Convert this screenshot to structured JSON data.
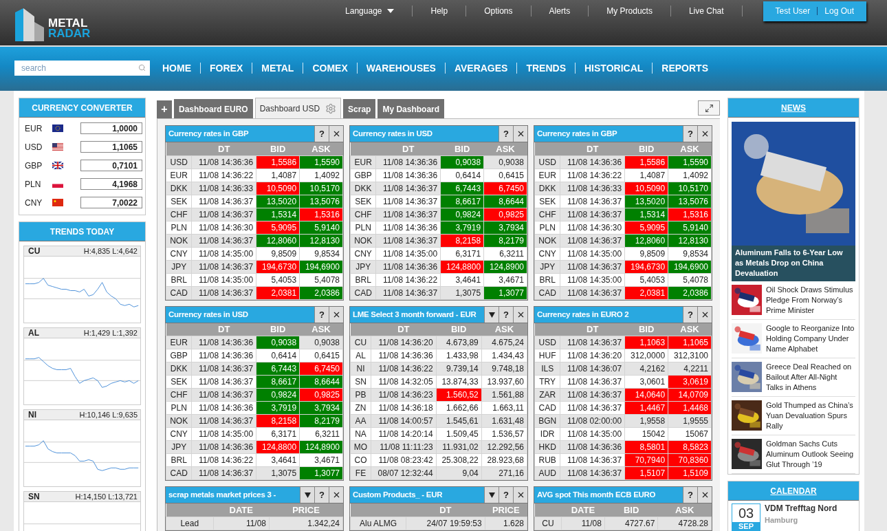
{
  "logo": {
    "line1": "METAL",
    "line2": "RADAR"
  },
  "top_menu": [
    {
      "label": "Language",
      "dropdown": true
    },
    {
      "label": "Help",
      "dropdown": false
    },
    {
      "label": "Options",
      "dropdown": false
    },
    {
      "label": "Alerts",
      "dropdown": false
    },
    {
      "label": "My Products",
      "dropdown": false
    },
    {
      "label": "Live Chat",
      "dropdown": false
    }
  ],
  "user": {
    "name": "Test User",
    "logout": "Log Out"
  },
  "search": {
    "placeholder": "search"
  },
  "nav": [
    "HOME",
    "FOREX",
    "METAL",
    "COMEX",
    "WAREHOUSES",
    "AVERAGES",
    "TRENDS",
    "HISTORICAL",
    "REPORTS"
  ],
  "converter": {
    "title": "CURRENCY CONVERTER",
    "rows": [
      {
        "code": "EUR",
        "value": "1,0000"
      },
      {
        "code": "USD",
        "value": "1,1065"
      },
      {
        "code": "GBP",
        "value": "0,7101"
      },
      {
        "code": "PLN",
        "value": "4,1968"
      },
      {
        "code": "CNY",
        "value": "7,0022"
      }
    ]
  },
  "trends": {
    "title": "TRENDS TODAY",
    "items": [
      {
        "metal": "CU",
        "range": "H:4,835 L:4,642"
      },
      {
        "metal": "AL",
        "range": "H:1,429 L:1,392"
      },
      {
        "metal": "NI",
        "range": "H:10,146 L:9,635"
      },
      {
        "metal": "SN",
        "range": "H:14,150 L:13,721"
      }
    ]
  },
  "tabs": {
    "add": "+",
    "items": [
      {
        "label": "Dashboard EURO",
        "selected": false
      },
      {
        "label": "Dashboard USD",
        "selected": true
      },
      {
        "label": "Scrap",
        "selected": false
      },
      {
        "label": "My Dashboard",
        "selected": false
      }
    ]
  },
  "widgets": [
    {
      "title": "Currency rates in GBP",
      "dropdown": false,
      "help": "?",
      "columns": [
        "",
        "DT",
        "BID",
        "ASK"
      ],
      "rows": [
        {
          "cells": [
            "USD",
            "11/08 14:36:36",
            {
              "text": "1,5586",
              "color": "#ff0000"
            },
            {
              "text": "1,5590",
              "color": "#008000"
            }
          ]
        },
        {
          "cells": [
            "EUR",
            "11/08 14:36:22",
            "1,4087",
            "1,4092"
          ]
        },
        {
          "cells": [
            "DKK",
            "11/08 14:36:33",
            {
              "text": "10,5090",
              "color": "#ff0000"
            },
            {
              "text": "10,5170",
              "color": "#008000"
            }
          ]
        },
        {
          "cells": [
            "SEK",
            "11/08 14:36:37",
            {
              "text": "13,5020",
              "color": "#008000"
            },
            {
              "text": "13,5076",
              "color": "#008000"
            }
          ]
        },
        {
          "cells": [
            "CHF",
            "11/08 14:36:37",
            {
              "text": "1,5314",
              "color": "#008000"
            },
            {
              "text": "1,5316",
              "color": "#ff0000"
            }
          ]
        },
        {
          "cells": [
            "PLN",
            "11/08 14:36:30",
            {
              "text": "5,9095",
              "color": "#ff0000"
            },
            {
              "text": "5,9140",
              "color": "#008000"
            }
          ]
        },
        {
          "cells": [
            "NOK",
            "11/08 14:36:37",
            {
              "text": "12,8060",
              "color": "#008000"
            },
            {
              "text": "12,8130",
              "color": "#008000"
            }
          ]
        },
        {
          "cells": [
            "CNY",
            "11/08 14:35:00",
            "9,8509",
            "9,8534"
          ]
        },
        {
          "cells": [
            "JPY",
            "11/08 14:36:37",
            {
              "text": "194,6730",
              "color": "#ff0000"
            },
            {
              "text": "194,6900",
              "color": "#008000"
            }
          ]
        },
        {
          "cells": [
            "BRL",
            "11/08 14:35:00",
            "5,4053",
            "5,4078"
          ]
        },
        {
          "cells": [
            "CAD",
            "11/08 14:36:37",
            {
              "text": "2,0381",
              "color": "#ff0000"
            },
            {
              "text": "2,0386",
              "color": "#008000"
            }
          ]
        }
      ]
    },
    {
      "title": "Currency rates in USD",
      "dropdown": false,
      "help": "?",
      "columns": [
        "",
        "DT",
        "BID",
        "ASK"
      ],
      "rows": [
        {
          "cells": [
            "EUR",
            "11/08 14:36:36",
            {
              "text": "0,9038",
              "color": "#008000"
            },
            "0,9038"
          ]
        },
        {
          "cells": [
            "GBP",
            "11/08 14:36:36",
            "0,6414",
            "0,6415"
          ]
        },
        {
          "cells": [
            "DKK",
            "11/08 14:36:37",
            {
              "text": "6,7443",
              "color": "#008000"
            },
            {
              "text": "6,7450",
              "color": "#ff0000"
            }
          ]
        },
        {
          "cells": [
            "SEK",
            "11/08 14:36:37",
            {
              "text": "8,6617",
              "color": "#008000"
            },
            {
              "text": "8,6644",
              "color": "#008000"
            }
          ]
        },
        {
          "cells": [
            "CHF",
            "11/08 14:36:37",
            {
              "text": "0,9824",
              "color": "#008000"
            },
            {
              "text": "0,9825",
              "color": "#ff0000"
            }
          ]
        },
        {
          "cells": [
            "PLN",
            "11/08 14:36:36",
            {
              "text": "3,7919",
              "color": "#008000"
            },
            {
              "text": "3,7934",
              "color": "#008000"
            }
          ]
        },
        {
          "cells": [
            "NOK",
            "11/08 14:36:37",
            {
              "text": "8,2158",
              "color": "#ff0000"
            },
            {
              "text": "8,2179",
              "color": "#008000"
            }
          ]
        },
        {
          "cells": [
            "CNY",
            "11/08 14:35:00",
            "6,3171",
            "6,3211"
          ]
        },
        {
          "cells": [
            "JPY",
            "11/08 14:36:36",
            {
              "text": "124,8800",
              "color": "#ff0000"
            },
            {
              "text": "124,8900",
              "color": "#008000"
            }
          ]
        },
        {
          "cells": [
            "BRL",
            "11/08 14:36:22",
            "3,4641",
            "3,4671"
          ]
        },
        {
          "cells": [
            "CAD",
            "11/08 14:36:37",
            "1,3075",
            {
              "text": "1,3077",
              "color": "#008000"
            }
          ]
        }
      ]
    },
    {
      "title": "Currency rates in GBP",
      "dropdown": false,
      "help": "?",
      "columns": [
        "",
        "DT",
        "BID",
        "ASK"
      ],
      "rows": [
        {
          "cells": [
            "USD",
            "11/08 14:36:36",
            {
              "text": "1,5586",
              "color": "#ff0000"
            },
            {
              "text": "1,5590",
              "color": "#008000"
            }
          ]
        },
        {
          "cells": [
            "EUR",
            "11/08 14:36:22",
            "1,4087",
            "1,4092"
          ]
        },
        {
          "cells": [
            "DKK",
            "11/08 14:36:33",
            {
              "text": "10,5090",
              "color": "#ff0000"
            },
            {
              "text": "10,5170",
              "color": "#008000"
            }
          ]
        },
        {
          "cells": [
            "SEK",
            "11/08 14:36:37",
            {
              "text": "13,5020",
              "color": "#008000"
            },
            {
              "text": "13,5076",
              "color": "#008000"
            }
          ]
        },
        {
          "cells": [
            "CHF",
            "11/08 14:36:37",
            {
              "text": "1,5314",
              "color": "#008000"
            },
            {
              "text": "1,5316",
              "color": "#ff0000"
            }
          ]
        },
        {
          "cells": [
            "PLN",
            "11/08 14:36:30",
            {
              "text": "5,9095",
              "color": "#ff0000"
            },
            {
              "text": "5,9140",
              "color": "#008000"
            }
          ]
        },
        {
          "cells": [
            "NOK",
            "11/08 14:36:37",
            {
              "text": "12,8060",
              "color": "#008000"
            },
            {
              "text": "12,8130",
              "color": "#008000"
            }
          ]
        },
        {
          "cells": [
            "CNY",
            "11/08 14:35:00",
            "9,8509",
            "9,8534"
          ]
        },
        {
          "cells": [
            "JPY",
            "11/08 14:36:37",
            {
              "text": "194,6730",
              "color": "#ff0000"
            },
            {
              "text": "194,6900",
              "color": "#008000"
            }
          ]
        },
        {
          "cells": [
            "BRL",
            "11/08 14:35:00",
            "5,4053",
            "5,4078"
          ]
        },
        {
          "cells": [
            "CAD",
            "11/08 14:36:37",
            {
              "text": "2,0381",
              "color": "#ff0000"
            },
            {
              "text": "2,0386",
              "color": "#008000"
            }
          ]
        }
      ]
    },
    {
      "title": "Currency rates in USD",
      "dropdown": false,
      "help": "?",
      "columns": [
        "",
        "DT",
        "BID",
        "ASK"
      ],
      "rows": [
        {
          "cells": [
            "EUR",
            "11/08 14:36:36",
            {
              "text": "0,9038",
              "color": "#008000"
            },
            "0,9038"
          ]
        },
        {
          "cells": [
            "GBP",
            "11/08 14:36:36",
            "0,6414",
            "0,6415"
          ]
        },
        {
          "cells": [
            "DKK",
            "11/08 14:36:37",
            {
              "text": "6,7443",
              "color": "#008000"
            },
            {
              "text": "6,7450",
              "color": "#ff0000"
            }
          ]
        },
        {
          "cells": [
            "SEK",
            "11/08 14:36:37",
            {
              "text": "8,6617",
              "color": "#008000"
            },
            {
              "text": "8,6644",
              "color": "#008000"
            }
          ]
        },
        {
          "cells": [
            "CHF",
            "11/08 14:36:37",
            {
              "text": "0,9824",
              "color": "#008000"
            },
            {
              "text": "0,9825",
              "color": "#ff0000"
            }
          ]
        },
        {
          "cells": [
            "PLN",
            "11/08 14:36:36",
            {
              "text": "3,7919",
              "color": "#008000"
            },
            {
              "text": "3,7934",
              "color": "#008000"
            }
          ]
        },
        {
          "cells": [
            "NOK",
            "11/08 14:36:37",
            {
              "text": "8,2158",
              "color": "#ff0000"
            },
            {
              "text": "8,2179",
              "color": "#008000"
            }
          ]
        },
        {
          "cells": [
            "CNY",
            "11/08 14:35:00",
            "6,3171",
            "6,3211"
          ]
        },
        {
          "cells": [
            "JPY",
            "11/08 14:36:36",
            {
              "text": "124,8800",
              "color": "#ff0000"
            },
            {
              "text": "124,8900",
              "color": "#008000"
            }
          ]
        },
        {
          "cells": [
            "BRL",
            "11/08 14:36:22",
            "3,4641",
            "3,4671"
          ]
        },
        {
          "cells": [
            "CAD",
            "11/08 14:36:37",
            "1,3075",
            {
              "text": "1,3077",
              "color": "#008000"
            }
          ]
        }
      ]
    },
    {
      "title": "LME Select 3 month forward - EUR",
      "dropdown": true,
      "help": "?",
      "columns": [
        "",
        "DT",
        "BID",
        "ASK"
      ],
      "rows": [
        {
          "cells": [
            "CU",
            "11/08 14:36:20",
            "4.673,89",
            "4.675,24"
          ]
        },
        {
          "cells": [
            "AL",
            "11/08 14:36:36",
            "1.433,98",
            "1.434,43"
          ]
        },
        {
          "cells": [
            "NI",
            "11/08 14:36:22",
            "9.739,14",
            "9.748,18"
          ]
        },
        {
          "cells": [
            "SN",
            "11/08 14:32:05",
            "13.874,33",
            "13.937,60"
          ]
        },
        {
          "cells": [
            "PB",
            "11/08 14:36:23",
            {
              "text": "1.560,52",
              "color": "#ff0000"
            },
            "1.561,88"
          ]
        },
        {
          "cells": [
            "ZN",
            "11/08 14:36:18",
            "1.662,66",
            "1.663,11"
          ]
        },
        {
          "cells": [
            "AA",
            "11/08 14:00:57",
            "1.545,61",
            "1.631,48"
          ]
        },
        {
          "cells": [
            "NA",
            "11/08 14:20:14",
            "1.509,45",
            "1.536,57"
          ]
        },
        {
          "cells": [
            "MO",
            "11/08 11:11:23",
            "11.931,02",
            "12.292,56"
          ]
        },
        {
          "cells": [
            "CO",
            "11/08 08:23:42",
            "25.308,22",
            "28.923,68"
          ]
        },
        {
          "cells": [
            "FE",
            "08/07 12:32:44",
            "9,04",
            "271,16"
          ]
        }
      ]
    },
    {
      "title": "Currency rates in EURO 2",
      "dropdown": false,
      "help": "?",
      "columns": [
        "",
        "DT",
        "BID",
        "ASK"
      ],
      "rows": [
        {
          "cells": [
            "USD",
            "11/08 14:36:37",
            {
              "text": "1,1063",
              "color": "#ff0000"
            },
            {
              "text": "1,1065",
              "color": "#ff0000"
            }
          ]
        },
        {
          "cells": [
            "HUF",
            "11/08 14:36:20",
            "312,0000",
            "312,3100"
          ]
        },
        {
          "cells": [
            "ILS",
            "11/08 14:36:07",
            "4,2162",
            "4,2211"
          ]
        },
        {
          "cells": [
            "TRY",
            "11/08 14:36:37",
            "3,0601",
            {
              "text": "3,0619",
              "color": "#ff0000"
            }
          ]
        },
        {
          "cells": [
            "ZAR",
            "11/08 14:36:37",
            {
              "text": "14,0640",
              "color": "#ff0000"
            },
            {
              "text": "14,0709",
              "color": "#ff0000"
            }
          ]
        },
        {
          "cells": [
            "CAD",
            "11/08 14:36:37",
            {
              "text": "1,4467",
              "color": "#ff0000"
            },
            {
              "text": "1,4468",
              "color": "#ff0000"
            }
          ]
        },
        {
          "cells": [
            "BGN",
            "11/08 02:00:00",
            "1,9558",
            "1,9555"
          ]
        },
        {
          "cells": [
            "IDR",
            "11/08 14:35:00",
            "15042",
            "15067"
          ]
        },
        {
          "cells": [
            "HKD",
            "11/08 14:36:36",
            {
              "text": "8,5801",
              "color": "#ff0000"
            },
            {
              "text": "8,5823",
              "color": "#ff0000"
            }
          ]
        },
        {
          "cells": [
            "RUB",
            "11/08 14:36:37",
            {
              "text": "70,7940",
              "color": "#ff0000"
            },
            {
              "text": "70,8360",
              "color": "#ff0000"
            }
          ]
        },
        {
          "cells": [
            "AUD",
            "11/08 14:36:37",
            {
              "text": "1,5107",
              "color": "#ff0000"
            },
            {
              "text": "1,5109",
              "color": "#ff0000"
            }
          ]
        }
      ]
    },
    {
      "title": "scrap metals market prices 3 -",
      "dropdown": true,
      "help": "?",
      "columns": [
        "",
        "DATE",
        "PRICE"
      ],
      "rows": [
        {
          "cells": [
            "Lead",
            "11/08",
            "1.342,24"
          ]
        }
      ]
    },
    {
      "title": "Custom Products_ - EUR",
      "dropdown": true,
      "help": "?",
      "columns": [
        "",
        "DT",
        "PRICE"
      ],
      "rows": [
        {
          "cells": [
            "Alu ALMG",
            "24/07 19:59:53",
            "1.628"
          ]
        }
      ]
    },
    {
      "title": "AVG spot This month ECB EURO",
      "dropdown": false,
      "help": "?",
      "columns": [
        "",
        "DATE",
        "BID",
        "ASK"
      ],
      "rows": [
        {
          "cells": [
            "CU",
            "11/08",
            "4727.67",
            "4728.28"
          ]
        }
      ]
    }
  ],
  "news": {
    "title": "NEWS",
    "feature": {
      "headline": "Aluminum Falls to 6-Year Low as Metals Drop on China Devaluation"
    },
    "items": [
      {
        "headline": "Oil Shock Draws Stimulus Pledge From Norway’s Prime Minister"
      },
      {
        "headline": "Google to Reorganize Into Holding Company Under Name Alphabet"
      },
      {
        "headline": "Greece Deal Reached on Bailout After All-Night Talks in Athens"
      },
      {
        "headline": "Gold Thumped as China’s Yuan Devaluation Spurs Rally"
      },
      {
        "headline": "Goldman Sachs Cuts Aluminum Outlook Seeing Glut Through ’19"
      }
    ]
  },
  "calendar": {
    "title": "CALENDAR",
    "events": [
      {
        "day": "03",
        "month": "SEP",
        "title": "VDM Trefftag Nord",
        "place": "Hamburg"
      }
    ]
  }
}
